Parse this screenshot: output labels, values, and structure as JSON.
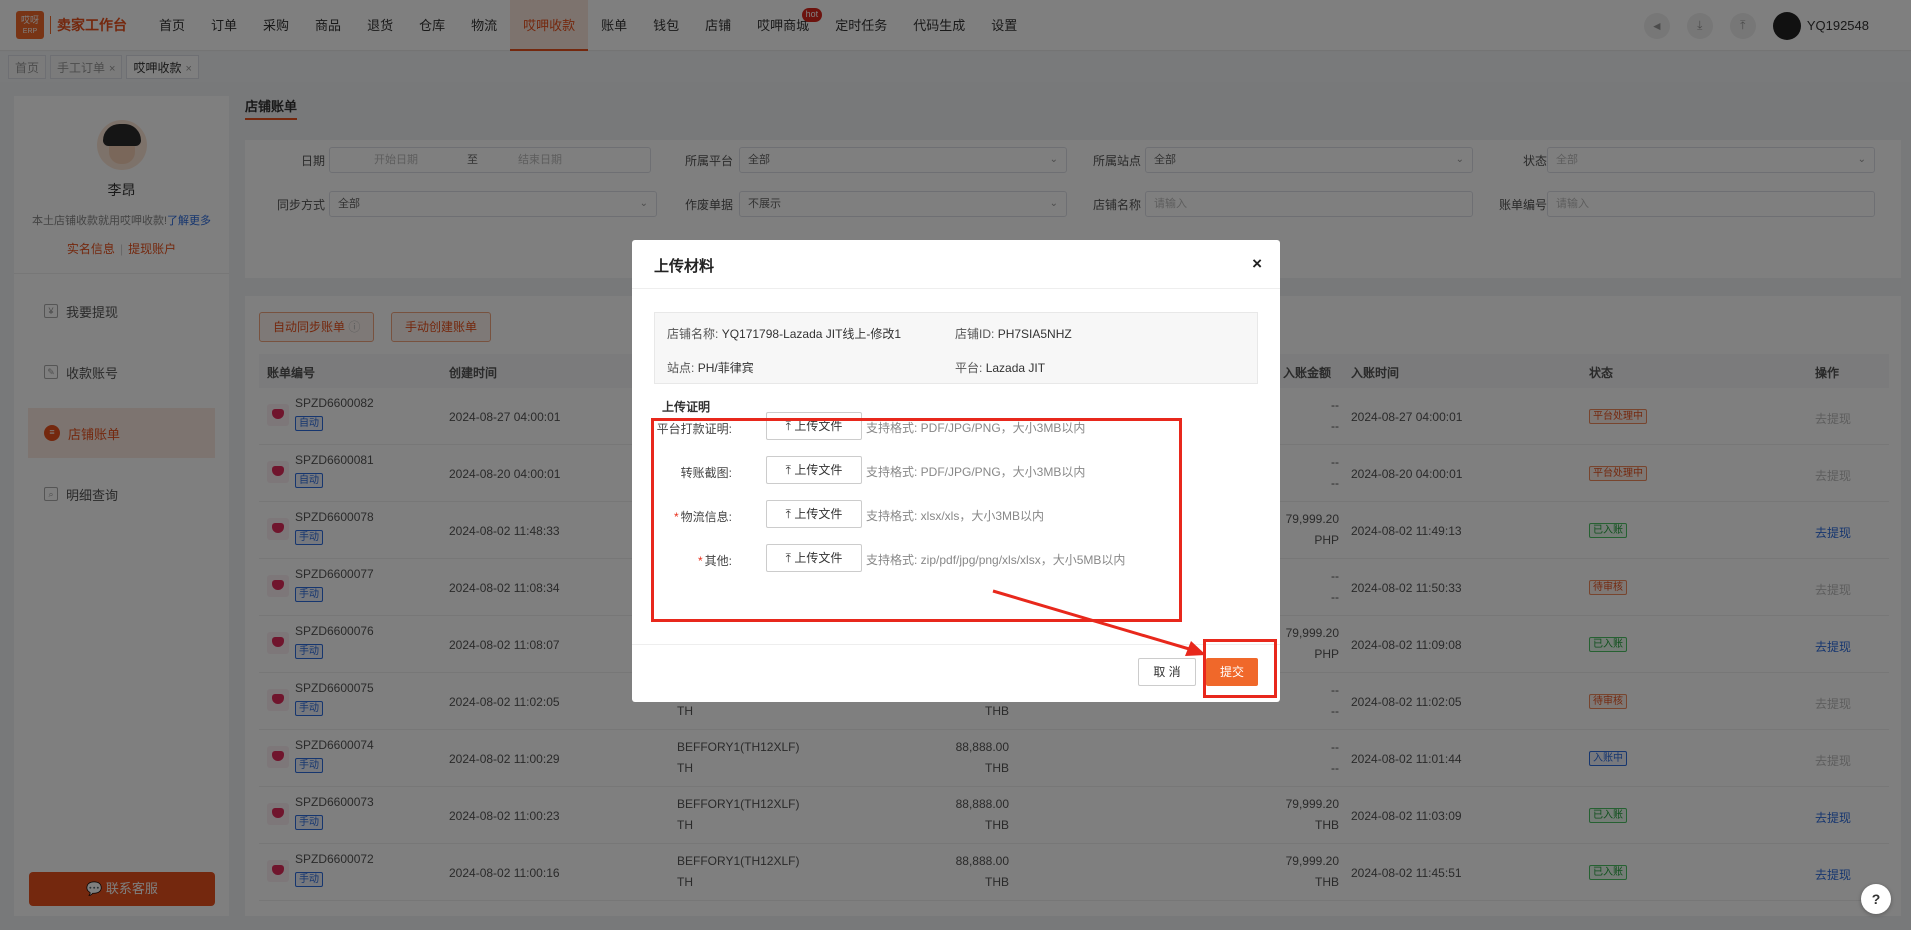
{
  "logo": {
    "text": "卖家工作台",
    "box_top": "哎呀",
    "box_bottom": "ERP"
  },
  "nav": [
    {
      "label": "首页"
    },
    {
      "label": "订单"
    },
    {
      "label": "采购"
    },
    {
      "label": "商品"
    },
    {
      "label": "退货"
    },
    {
      "label": "仓库"
    },
    {
      "label": "物流"
    },
    {
      "label": "哎呷收款"
    },
    {
      "label": "账单"
    },
    {
      "label": "钱包"
    },
    {
      "label": "店铺"
    },
    {
      "label": "哎呷商城"
    },
    {
      "label": "定时任务"
    },
    {
      "label": "代码生成"
    },
    {
      "label": "设置"
    }
  ],
  "nav_hot": "hot",
  "user": {
    "name": "YQ192548"
  },
  "tabs": [
    {
      "label": "首页"
    },
    {
      "label": "手工订单"
    },
    {
      "label": "哎呷收款"
    }
  ],
  "sidebar": {
    "name": "李昂",
    "desc": "本土店铺收款就用哎呷收款!",
    "desc_link": "了解更多",
    "link1": "实名信息",
    "link2": "提现账户",
    "items": [
      {
        "label": "我要提现"
      },
      {
        "label": "收款账号"
      },
      {
        "label": "店铺账单"
      },
      {
        "label": "明细查询"
      }
    ],
    "service": "联系客服"
  },
  "main": {
    "title": "店铺账单",
    "filters": {
      "date_label": "日期",
      "date_start": "开始日期",
      "date_to": "至",
      "date_end": "结束日期",
      "platform_label": "所属平台",
      "platform_value": "全部",
      "site_label": "所属站点",
      "site_value": "全部",
      "status_label": "状态",
      "status_value": "全部",
      "sync_label": "同步方式",
      "sync_value": "全部",
      "void_label": "作废单据",
      "void_value": "不展示",
      "shop_label": "店铺名称",
      "shop_placeholder": "请输入",
      "bill_label": "账单编号",
      "bill_placeholder": "请输入"
    },
    "btn_auto": "自动同步账单",
    "btn_manual": "手动创建账单",
    "columns": {
      "id": "账单编号",
      "created": "创建时间",
      "in_amount": "入账金额",
      "in_time": "入账时间",
      "status": "状态",
      "op": "操作"
    },
    "rows": [
      {
        "id": "SPZD6600082",
        "tag": "自动",
        "created": "2024-08-27 04:00:01",
        "shop": "",
        "site": "",
        "amount": "",
        "cur": "",
        "in1": "--",
        "in2": "--",
        "in_time": "2024-08-27 04:00:01",
        "status": "平台处理中",
        "status_type": "orange",
        "op": "去提现",
        "op_active": false
      },
      {
        "id": "SPZD6600081",
        "tag": "自动",
        "created": "2024-08-20 04:00:01",
        "shop": "",
        "site": "",
        "amount": "",
        "cur": "",
        "in1": "--",
        "in2": "--",
        "in_time": "2024-08-20 04:00:01",
        "status": "平台处理中",
        "status_type": "orange",
        "op": "去提现",
        "op_active": false
      },
      {
        "id": "SPZD6600078",
        "tag": "手动",
        "created": "2024-08-02 11:48:33",
        "shop": "",
        "site": "",
        "amount": "",
        "cur": "",
        "in1": "79,999.20",
        "in2": "PHP",
        "in_time": "2024-08-02 11:49:13",
        "status": "已入账",
        "status_type": "green",
        "op": "去提现",
        "op_active": true
      },
      {
        "id": "SPZD6600077",
        "tag": "手动",
        "created": "2024-08-02 11:08:34",
        "shop": "",
        "site": "",
        "amount": "",
        "cur": "",
        "in1": "--",
        "in2": "--",
        "in_time": "2024-08-02 11:50:33",
        "status": "待审核",
        "status_type": "orange",
        "op": "去提现",
        "op_active": false
      },
      {
        "id": "SPZD6600076",
        "tag": "手动",
        "created": "2024-08-02 11:08:07",
        "shop": "",
        "site": "",
        "amount": "",
        "cur": "",
        "in1": "79,999.20",
        "in2": "PHP",
        "in_time": "2024-08-02 11:09:08",
        "status": "已入账",
        "status_type": "green",
        "op": "去提现",
        "op_active": true
      },
      {
        "id": "SPZD6600075",
        "tag": "手动",
        "created": "2024-08-02 11:02:05",
        "shop": "",
        "site": "TH",
        "amount": "",
        "cur": "THB",
        "in1": "--",
        "in2": "--",
        "in_time": "2024-08-02 11:02:05",
        "status": "待审核",
        "status_type": "orange",
        "op": "去提现",
        "op_active": false
      },
      {
        "id": "SPZD6600074",
        "tag": "手动",
        "created": "2024-08-02 11:00:29",
        "shop": "BEFFORY1(TH12XLF)",
        "site": "TH",
        "amount": "88,888.00",
        "cur": "THB",
        "in1": "--",
        "in2": "--",
        "in_time": "2024-08-02 11:01:44",
        "status": "入账中",
        "status_type": "blue",
        "op": "去提现",
        "op_active": false
      },
      {
        "id": "SPZD6600073",
        "tag": "手动",
        "created": "2024-08-02 11:00:23",
        "shop": "BEFFORY1(TH12XLF)",
        "site": "TH",
        "amount": "88,888.00",
        "cur": "THB",
        "in1": "79,999.20",
        "in2": "THB",
        "in_time": "2024-08-02 11:03:09",
        "status": "已入账",
        "status_type": "green",
        "op": "去提现",
        "op_active": true
      },
      {
        "id": "SPZD6600072",
        "tag": "手动",
        "created": "2024-08-02 11:00:16",
        "shop": "BEFFORY1(TH12XLF)",
        "site": "TH",
        "amount": "88,888.00",
        "cur": "THB",
        "in1": "79,999.20",
        "in2": "THB",
        "in_time": "2024-08-02 11:45:51",
        "status": "已入账",
        "status_type": "green",
        "op": "去提现",
        "op_active": true
      }
    ]
  },
  "modal": {
    "title": "上传材料",
    "close": "×",
    "shop_name_key": "店铺名称:",
    "shop_name_val": "YQ171798-Lazada JIT线上-修改1",
    "shop_id_key": "店铺ID:",
    "shop_id_val": "PH7SIA5NHZ",
    "site_key": "站点:",
    "site_val": "PH/菲律宾",
    "platform_key": "平台:",
    "platform_val": "Lazada JIT",
    "section": "上传证明",
    "upload_label": "上传文件",
    "rows": [
      {
        "label": "平台打款证明:",
        "required": false,
        "hint": "支持格式: PDF/JPG/PNG，大小3MB以内"
      },
      {
        "label": "转账截图:",
        "required": false,
        "hint": "支持格式: PDF/JPG/PNG，大小3MB以内"
      },
      {
        "label": "物流信息:",
        "required": true,
        "hint": "支持格式: xlsx/xls，大小3MB以内"
      },
      {
        "label": "其他:",
        "required": true,
        "hint": "支持格式: zip/pdf/jpg/png/xls/xlsx，大小5MB以内"
      }
    ],
    "cancel": "取 消",
    "submit": "提交"
  },
  "colors": {
    "accent": "#e8501c",
    "annotation": "#e8281c"
  }
}
